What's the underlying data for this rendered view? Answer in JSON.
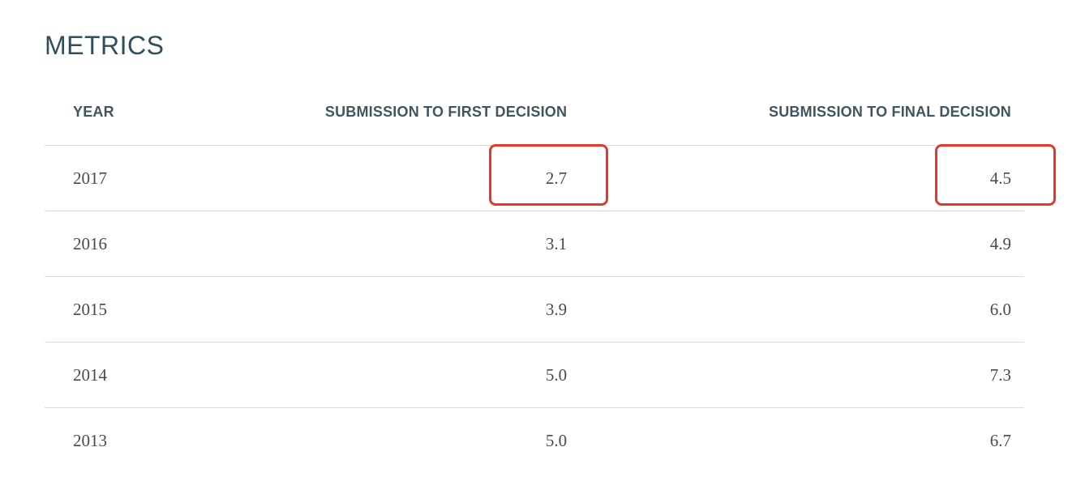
{
  "page": {
    "title": "METRICS"
  },
  "table": {
    "headers": {
      "year": "YEAR",
      "first_decision": "SUBMISSION TO FIRST DECISION",
      "final_decision": "SUBMISSION TO FINAL DECISION"
    },
    "rows": [
      {
        "year": "2017",
        "first_decision": "2.7",
        "final_decision": "4.5"
      },
      {
        "year": "2016",
        "first_decision": "3.1",
        "final_decision": "4.9"
      },
      {
        "year": "2015",
        "first_decision": "3.9",
        "final_decision": "6.0"
      },
      {
        "year": "2014",
        "first_decision": "5.0",
        "final_decision": "7.3"
      },
      {
        "year": "2013",
        "first_decision": "5.0",
        "final_decision": "6.7"
      }
    ]
  },
  "annotations": {
    "highlight_color": "#e23b2e",
    "highlighted_cells": [
      "2017 submission to first decision",
      "2017 submission to final decision"
    ]
  }
}
